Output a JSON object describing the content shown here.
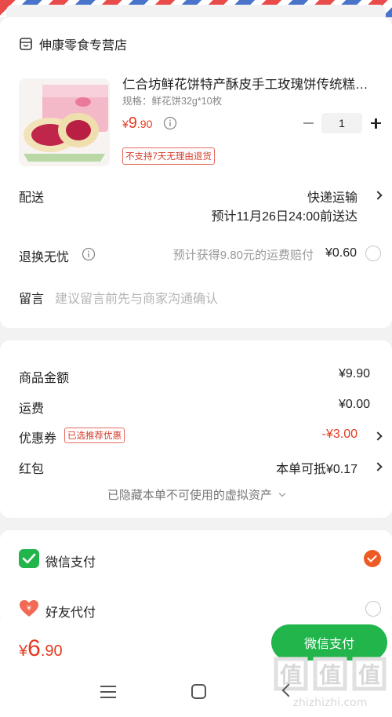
{
  "shop": {
    "name": "伸康零食专营店",
    "icon": "shop-icon"
  },
  "product": {
    "title": "仁合坊鲜花饼特产酥皮手工玫瑰饼传统糕…",
    "spec": "规格：鲜花饼32g*10枚",
    "price_symbol": "¥",
    "price_int": "9",
    "price_dec": ".90",
    "quantity": "1",
    "return_tag": "不支持7天无理由退货"
  },
  "delivery": {
    "label": "配送",
    "method": "快递运输",
    "eta": "预计11月26日24:00前送达"
  },
  "insurance": {
    "label": "退换无忧",
    "desc": "预计获得9.80元的运费赔付",
    "price": "¥0.60"
  },
  "note": {
    "label": "留言",
    "placeholder": "建议留言前先与商家沟通确认"
  },
  "summary": {
    "goods_label": "商品金额",
    "goods_value": "¥9.90",
    "shipping_label": "运费",
    "shipping_value": "¥0.00",
    "coupon_label": "优惠券",
    "coupon_tag": "已选推荐优惠",
    "coupon_value": "-¥3.00",
    "redpacket_label": "红包",
    "redpacket_value": "本单可抵¥0.17",
    "hidden_note": "已隐藏本单不可使用的虚拟资产"
  },
  "payment": {
    "wechat_label": "微信支付",
    "friend_label": "好友代付"
  },
  "footer": {
    "total_symbol": "¥",
    "total_int": "6",
    "total_dec": ".90",
    "pay_button": "微信支付"
  },
  "watermark": {
    "brand": "值",
    "url": "zhizhizhi.com"
  },
  "colors": {
    "accent": "#e53a1f",
    "wechat_green": "#21b54b",
    "check_orange": "#ee5a24"
  }
}
